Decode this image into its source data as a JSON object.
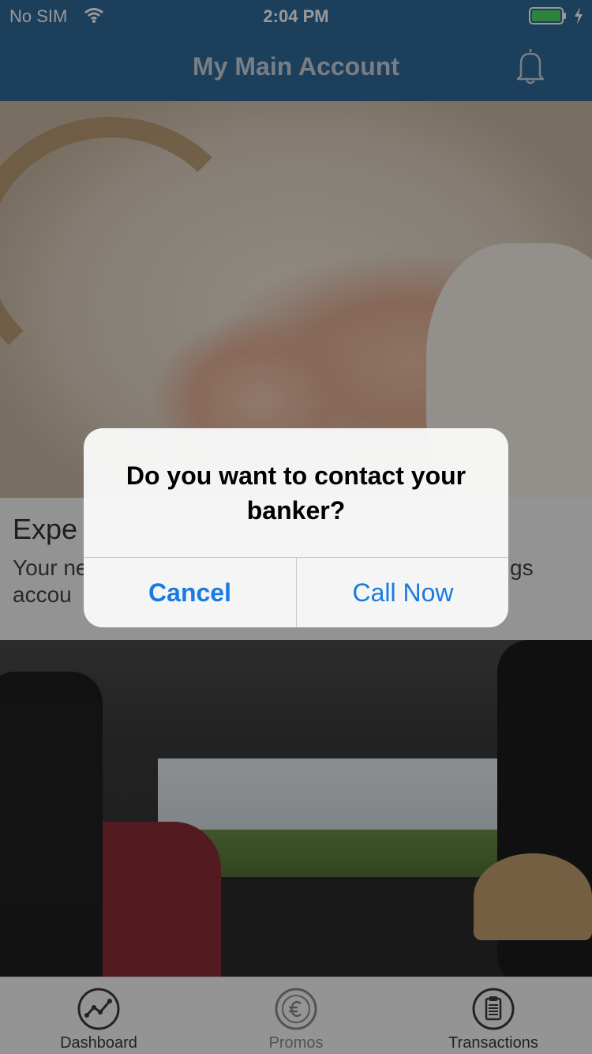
{
  "status_bar": {
    "carrier": "No SIM",
    "time": "2:04 PM",
    "battery_color": "#4cd964"
  },
  "nav": {
    "title": "My Main Account"
  },
  "card": {
    "title": "Expe",
    "body_line1": "Your ne",
    "body_line1_tail": "gs",
    "body_line2": "accou"
  },
  "alert": {
    "message": "Do you want to contact your banker?",
    "cancel_label": "Cancel",
    "call_label": "Call Now",
    "button_color": "#1a7ae0"
  },
  "tabs": [
    {
      "label": "Dashboard",
      "icon": "chart-line-icon"
    },
    {
      "label": "Promos",
      "icon": "euro-icon"
    },
    {
      "label": "Transactions",
      "icon": "clipboard-icon"
    }
  ],
  "colors": {
    "nav_background": "#2f6a9a"
  }
}
